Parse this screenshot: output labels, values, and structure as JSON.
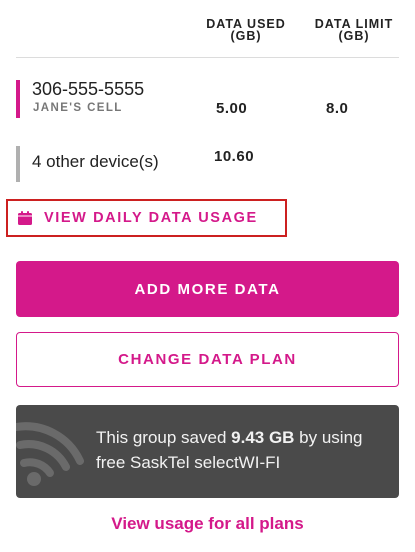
{
  "table": {
    "header_used": "DATA USED (GB)",
    "header_limit": "DATA LIMIT (GB)"
  },
  "devices": [
    {
      "phone": "306-555-5555",
      "name": "JANE'S CELL",
      "used": "5.00",
      "limit": "8.0",
      "bar_color": "#d4198a"
    },
    {
      "label": "4 other device(s)",
      "used": "10.60",
      "bar_color": "#b0b0b0"
    }
  ],
  "links": {
    "daily_usage": "VIEW DAILY DATA USAGE",
    "all_plans": "View usage for all plans"
  },
  "buttons": {
    "add_data": "ADD MORE DATA",
    "change_plan": "CHANGE DATA PLAN"
  },
  "wifi_card": {
    "prefix": "This group saved ",
    "amount": "9.43 GB",
    "suffix": " by using free SaskTel selectWI-FI"
  },
  "colors": {
    "accent": "#d4198a",
    "card_bg": "#4a4a4a",
    "highlight_border": "#cc2020"
  },
  "icons": {
    "calendar": "calendar-icon",
    "wifi": "wifi-icon"
  }
}
